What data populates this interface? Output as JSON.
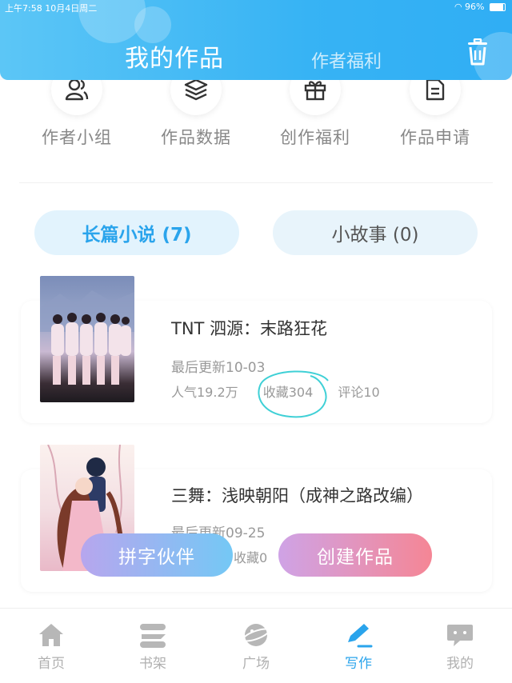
{
  "status_bar": {
    "time_date": "上午7:58  10月4日周二",
    "battery": "96%"
  },
  "header": {
    "title": "我的作品",
    "tab2": "作者福利",
    "trash_icon": "trash-icon"
  },
  "quick_actions": [
    {
      "label": "作者小组",
      "icon": "user-group-icon"
    },
    {
      "label": "作品数据",
      "icon": "layers-icon"
    },
    {
      "label": "创作福利",
      "icon": "gift-icon"
    },
    {
      "label": "作品申请",
      "icon": "document-icon"
    }
  ],
  "category_tabs": [
    {
      "label": "长篇小说 (7)",
      "active": true
    },
    {
      "label": "小故事 (0)",
      "active": false
    }
  ],
  "works": [
    {
      "title": "TNT 泗源：末路狂花",
      "updated": "最后更新10-03",
      "popularity": "人气19.2万",
      "favorites": "收藏304",
      "comments": "评论10"
    },
    {
      "title": "三舞：浅映朝阳（成神之路改编）",
      "updated": "最后更新09-25",
      "favorites": "收藏0"
    }
  ],
  "fab": {
    "partner": "拼字伙伴",
    "create": "创建作品"
  },
  "tab_bar": [
    {
      "label": "首页",
      "icon": "home-icon"
    },
    {
      "label": "书架",
      "icon": "bookshelf-icon"
    },
    {
      "label": "广场",
      "icon": "planet-icon"
    },
    {
      "label": "写作",
      "icon": "pen-icon",
      "active": true
    },
    {
      "label": "我的",
      "icon": "chat-bubble-icon"
    }
  ],
  "colors": {
    "accent": "#2aa4ec",
    "header": "#37b3f4"
  }
}
